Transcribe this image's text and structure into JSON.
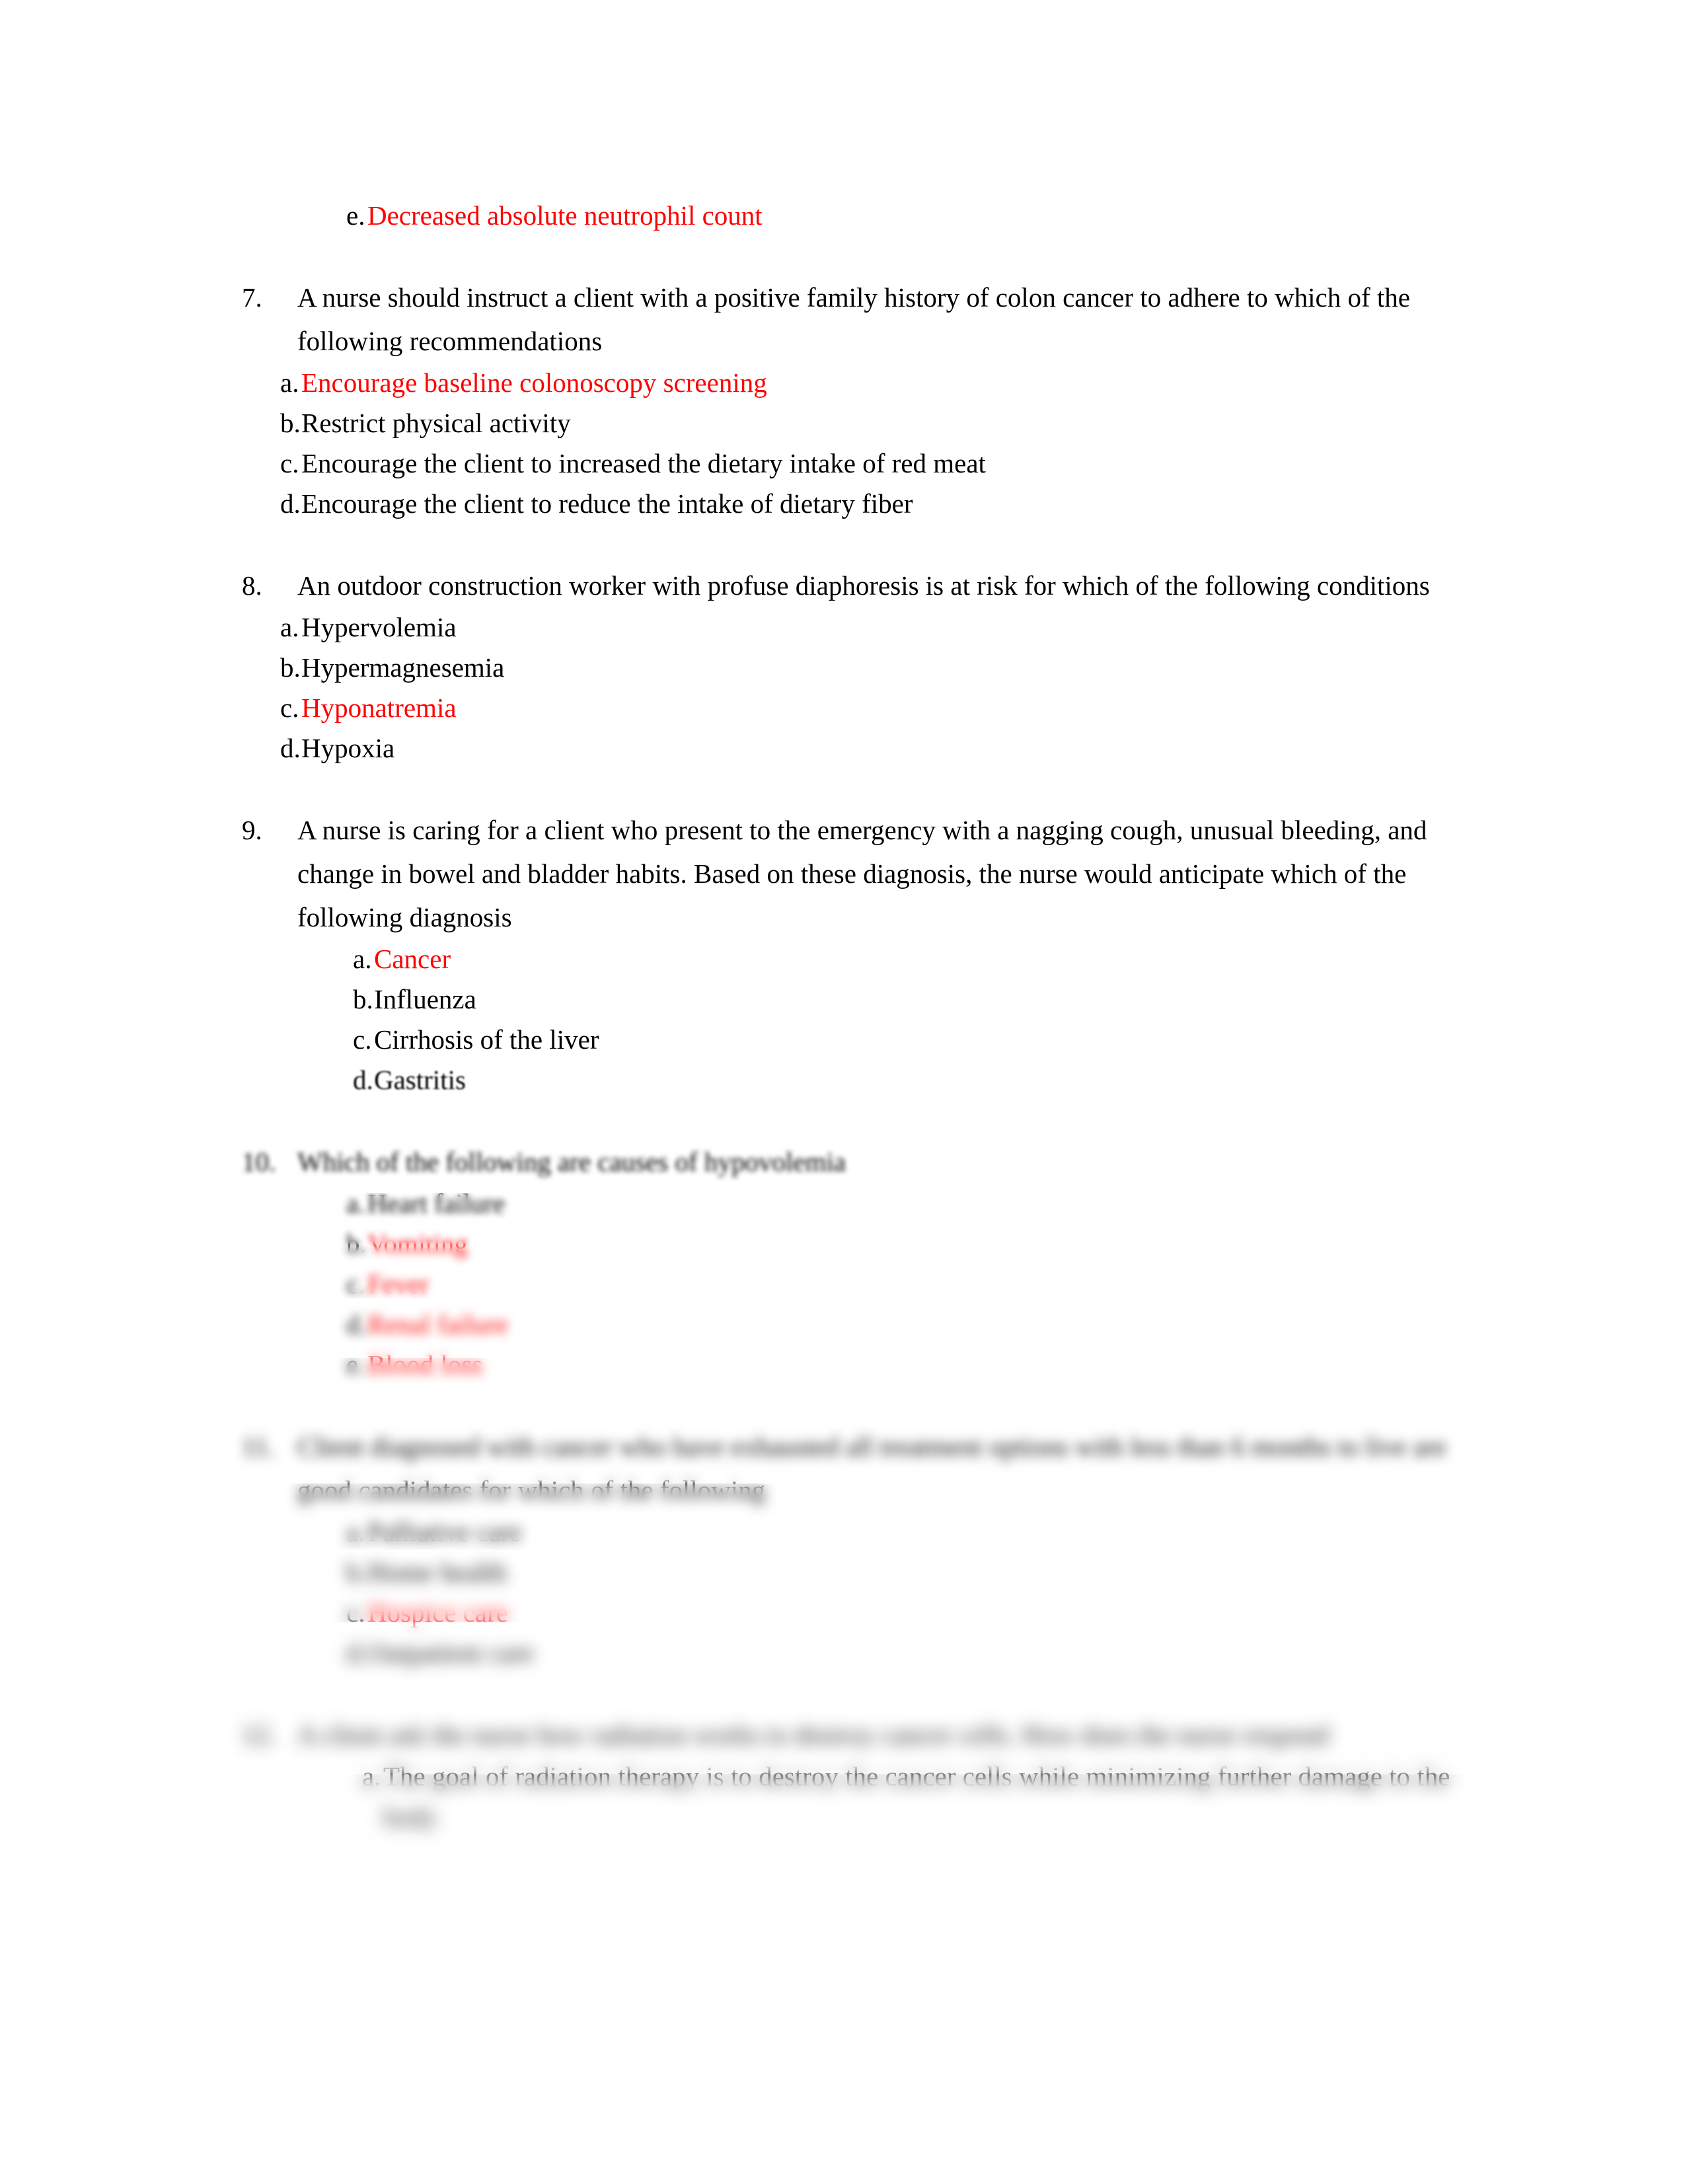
{
  "document": {
    "type": "nursing-exam-answer-key",
    "page_background": "#ffffff",
    "answer_color": "#ff0000",
    "body_color": "#000000"
  },
  "carryover_option": {
    "letter": "e.",
    "text": "Decreased absolute neutrophil count",
    "is_answer": true
  },
  "questions": [
    {
      "number": "7.",
      "stem": "A nurse should instruct a client with a positive family history of colon cancer to adhere to which of the following recommendations",
      "options": [
        {
          "letter": "a.",
          "text": "Encourage baseline colonoscopy screening",
          "is_answer": true
        },
        {
          "letter": "b.",
          "text": "Restrict physical activity",
          "is_answer": false
        },
        {
          "letter": "c.",
          "text": "Encourage the client to increased the dietary intake of red meat",
          "is_answer": false
        },
        {
          "letter": "d.",
          "text": "Encourage the client to reduce the intake of dietary fiber",
          "is_answer": false
        }
      ]
    },
    {
      "number": "8.",
      "stem": "An outdoor construction worker with profuse diaphoresis is at risk for which of the following conditions",
      "options": [
        {
          "letter": "a.",
          "text": "Hypervolemia",
          "is_answer": false
        },
        {
          "letter": "b.",
          "text": "Hypermagnesemia",
          "is_answer": false
        },
        {
          "letter": "c.",
          "text": "Hyponatremia",
          "is_answer": true
        },
        {
          "letter": "d.",
          "text": "Hypoxia",
          "is_answer": false
        }
      ]
    },
    {
      "number": "9.",
      "stem": "A nurse is caring for a client who present to the emergency with a nagging cough, unusual bleeding, and change in bowel and bladder habits. Based on these diagnosis, the nurse would anticipate which of the following diagnosis",
      "options": [
        {
          "letter": "a.",
          "text": "Cancer",
          "is_answer": true
        },
        {
          "letter": "b.",
          "text": "Influenza",
          "is_answer": false
        },
        {
          "letter": "c.",
          "text": "Cirrhosis of the liver",
          "is_answer": false
        },
        {
          "letter": "d.",
          "text": "Gastritis",
          "is_answer": false
        }
      ]
    },
    {
      "number": "10.",
      "stem": "Which of the following are causes of hypovolemia",
      "options": [
        {
          "letter": "a.",
          "text": "Heart failure",
          "is_answer": false
        },
        {
          "letter": "b.",
          "text": "Vomiting",
          "is_answer": true
        },
        {
          "letter": "c.",
          "text": "Fever",
          "is_answer": true
        },
        {
          "letter": "d.",
          "text": "Renal failure",
          "is_answer": true
        },
        {
          "letter": "e.",
          "text": "Blood loss",
          "is_answer": true
        }
      ]
    },
    {
      "number": "11.",
      "stem": "Client diagnosed with cancer who have exhausted all treatment options with less than 6 months to live are good candidates for which of the following",
      "options": [
        {
          "letter": "a.",
          "text": "Palliative care",
          "is_answer": false
        },
        {
          "letter": "b.",
          "text": "Home health",
          "is_answer": false
        },
        {
          "letter": "c.",
          "text": "Hospice care",
          "is_answer": true
        },
        {
          "letter": "d.",
          "text": "Outpatient care",
          "is_answer": false
        }
      ]
    },
    {
      "number": "12.",
      "stem": "A client ask the nurse how radiation works to destroy cancer cells. How does the nurse respond",
      "options": [
        {
          "letter": "a.",
          "text": "The goal of radiation therapy is to destroy the cancer cells while minimizing further damage to the body",
          "is_answer": false
        }
      ]
    }
  ]
}
